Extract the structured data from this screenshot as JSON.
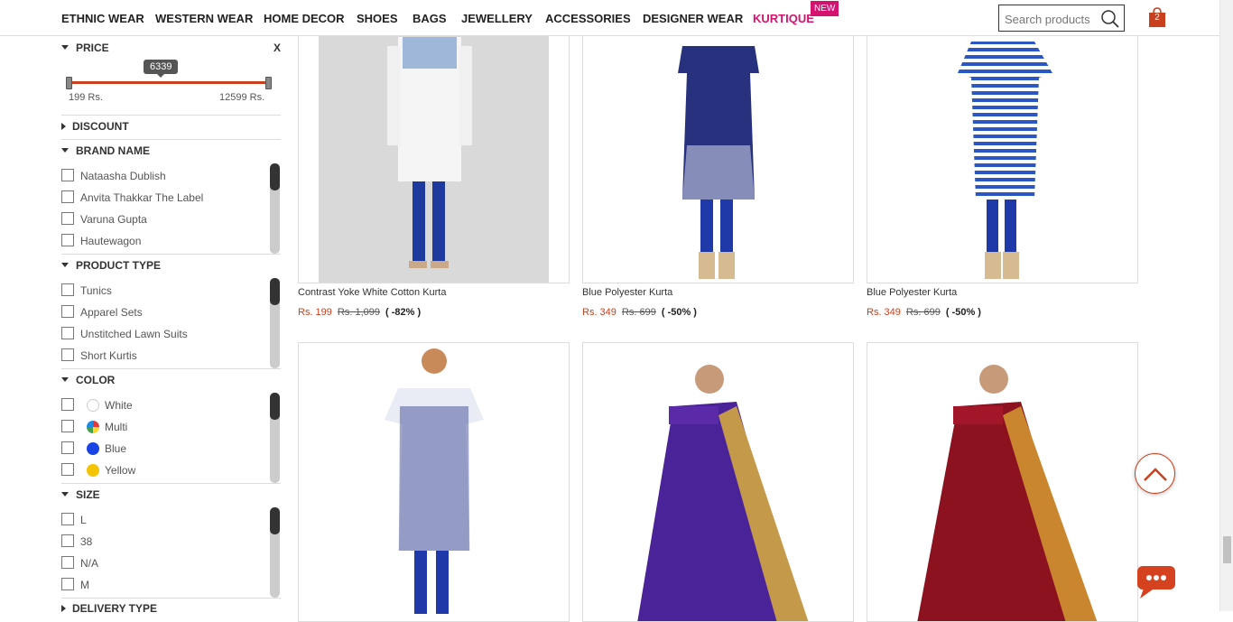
{
  "nav": {
    "items": [
      "ETHNIC WEAR",
      "WESTERN WEAR",
      "HOME DECOR",
      "SHOES",
      "BAGS",
      "JEWELLERY",
      "ACCESSORIES",
      "DESIGNER WEAR",
      "KURTIQUE"
    ],
    "new_badge": "NEW",
    "search_placeholder": "Search products",
    "cart_count": "2"
  },
  "filters": {
    "price": {
      "label": "PRICE",
      "clear": "X",
      "tooltip": "6339",
      "min_label": "199 Rs.",
      "max_label": "12599 Rs."
    },
    "discount": {
      "label": "DISCOUNT"
    },
    "brand": {
      "label": "BRAND NAME",
      "options": [
        "Nataasha Dublish",
        "Anvita Thakkar The Label",
        "Varuna Gupta",
        "Hautewagon"
      ]
    },
    "product_type": {
      "label": "PRODUCT TYPE",
      "options": [
        "Tunics",
        "Apparel Sets",
        "Unstitched Lawn Suits",
        "Short Kurtis"
      ]
    },
    "color": {
      "label": "COLOR",
      "options": [
        "White",
        "Multi",
        "Blue",
        "Yellow"
      ],
      "swatches": [
        "#ffffff",
        "multi",
        "#1a44e6",
        "#f5c400"
      ]
    },
    "size": {
      "label": "SIZE",
      "options": [
        "L",
        "38",
        "N/A",
        "M"
      ]
    },
    "delivery": {
      "label": "DELIVERY TYPE"
    }
  },
  "products": [
    {
      "title": "Contrast Yoke White Cotton Kurta",
      "price": "Rs. 199",
      "mrp": "Rs. 1,099",
      "discount": "( -82% )"
    },
    {
      "title": "Blue Polyester Kurta",
      "price": "Rs. 349",
      "mrp": "Rs. 699",
      "discount": "( -50% )"
    },
    {
      "title": "Blue Polyester Kurta",
      "price": "Rs. 349",
      "mrp": "Rs. 699",
      "discount": "( -50% )"
    },
    {
      "title": "",
      "price": "",
      "mrp": "",
      "discount": ""
    },
    {
      "title": "",
      "price": "",
      "mrp": "",
      "discount": ""
    },
    {
      "title": "",
      "price": "",
      "mrp": "",
      "discount": ""
    }
  ],
  "colors": {
    "accent": "#c8401d",
    "brand_pink": "#d4136f"
  }
}
